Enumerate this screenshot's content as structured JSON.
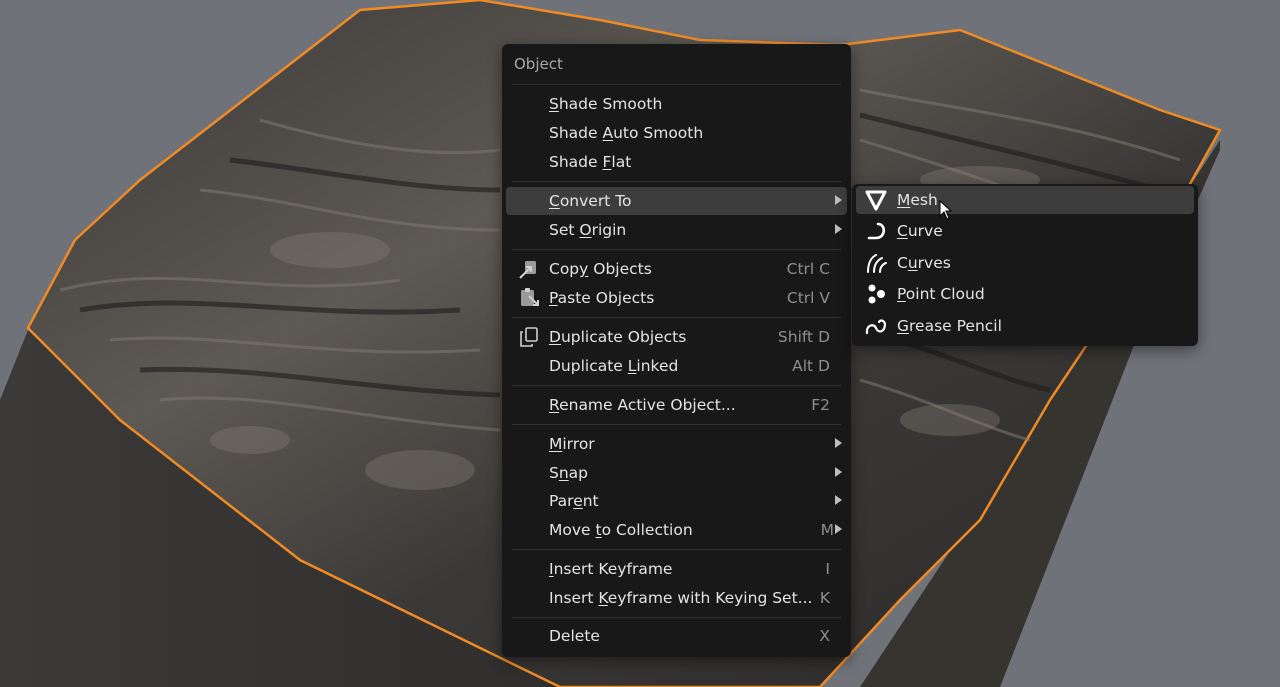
{
  "menu": {
    "title": "Object",
    "items": [
      {
        "pre": "",
        "ul": "S",
        "post": "hade Smooth",
        "shortcut": "",
        "submenu": false
      },
      {
        "pre": "Shade ",
        "ul": "A",
        "post": "uto Smooth",
        "shortcut": "",
        "submenu": false
      },
      {
        "pre": "Shade ",
        "ul": "F",
        "post": "lat",
        "shortcut": "",
        "submenu": false
      },
      {
        "pre": "",
        "ul": "C",
        "post": "onvert To",
        "shortcut": "",
        "submenu": true,
        "highlighted": true
      },
      {
        "pre": "Set ",
        "ul": "O",
        "post": "rigin",
        "shortcut": "",
        "submenu": true
      },
      {
        "pre": "Cop",
        "ul": "y",
        "post": " Objects",
        "shortcut": "Ctrl C",
        "submenu": false,
        "icon": "copy-icon"
      },
      {
        "pre": "",
        "ul": "P",
        "post": "aste Objects",
        "shortcut": "Ctrl V",
        "submenu": false,
        "icon": "paste-icon"
      },
      {
        "pre": "",
        "ul": "D",
        "post": "uplicate Objects",
        "shortcut": "Shift D",
        "submenu": false,
        "icon": "duplicate-icon"
      },
      {
        "pre": "Duplicate ",
        "ul": "L",
        "post": "inked",
        "shortcut": "Alt D",
        "submenu": false
      },
      {
        "pre": "",
        "ul": "R",
        "post": "ename Active Object...",
        "shortcut": "F2",
        "submenu": false
      },
      {
        "pre": "",
        "ul": "M",
        "post": "irror",
        "shortcut": "",
        "submenu": true
      },
      {
        "pre": "S",
        "ul": "n",
        "post": "ap",
        "shortcut": "",
        "submenu": true
      },
      {
        "pre": "Par",
        "ul": "e",
        "post": "nt",
        "shortcut": "",
        "submenu": true
      },
      {
        "pre": "Move ",
        "ul": "t",
        "post": "o Collection",
        "shortcut": "M",
        "submenu": true
      },
      {
        "pre": "",
        "ul": "I",
        "post": "nsert Keyframe",
        "shortcut": "I",
        "submenu": false
      },
      {
        "pre": "Insert ",
        "ul": "K",
        "post": "eyframe with Keying Set...",
        "shortcut": "K",
        "submenu": false
      },
      {
        "pre": "Delete",
        "ul": "",
        "post": "",
        "shortcut": "X",
        "submenu": false
      }
    ]
  },
  "submenu": {
    "items": [
      {
        "pre": "",
        "ul": "M",
        "post": "esh",
        "icon": "mesh-icon",
        "highlighted": true
      },
      {
        "pre": "",
        "ul": "C",
        "post": "urve",
        "icon": "curve-icon"
      },
      {
        "pre": "C",
        "ul": "u",
        "post": "rves",
        "icon": "curves-icon"
      },
      {
        "pre": "",
        "ul": "P",
        "post": "oint Cloud",
        "icon": "point-cloud-icon"
      },
      {
        "pre": "",
        "ul": "G",
        "post": "rease Pencil",
        "icon": "grease-pencil-icon"
      }
    ]
  },
  "colors": {
    "background": "#6f7278",
    "menu_bg": "#181818",
    "highlight": "#3d3d3d",
    "selection_outline": "#f08a24"
  }
}
